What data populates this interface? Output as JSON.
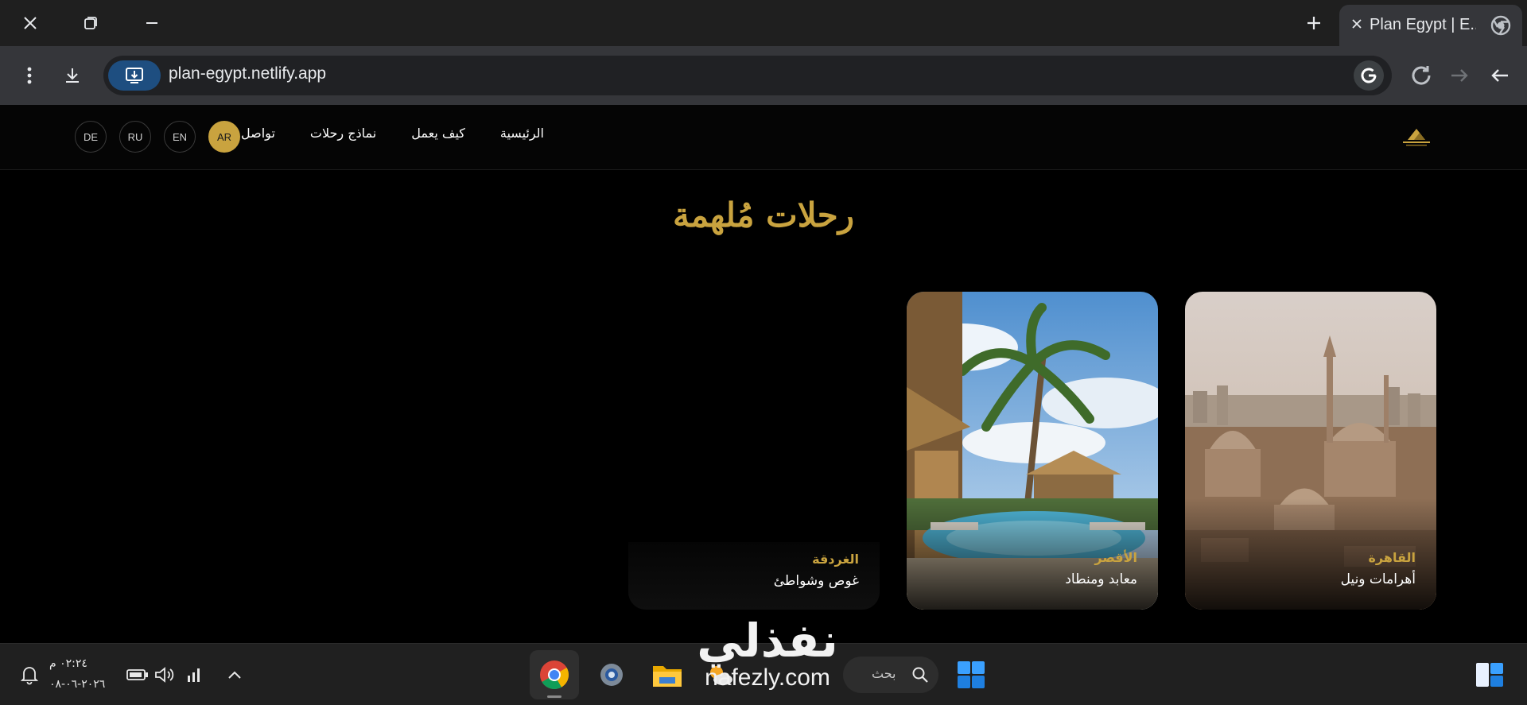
{
  "browser": {
    "tab_title": "Plan Egypt | E...",
    "url": "plan-egypt.netlify.app"
  },
  "site": {
    "nav": [
      {
        "id": "home",
        "label": "الرئيسية"
      },
      {
        "id": "how",
        "label": "كيف يعمل"
      },
      {
        "id": "samples",
        "label": "نماذج رحلات"
      },
      {
        "id": "contact",
        "label": "تواصل"
      }
    ],
    "languages": [
      "AR",
      "EN",
      "RU",
      "DE"
    ],
    "active_language": "AR",
    "hero_title": "رحلات مُلهمة",
    "accent_color": "#c9a33f",
    "cards": [
      {
        "city": "القاهرة",
        "subtitle": "أهرامات ونيل"
      },
      {
        "city": "الأقصر",
        "subtitle": "معابد ومنطاد"
      },
      {
        "city": "الغردقة",
        "subtitle": "غوص وشواطئ"
      }
    ]
  },
  "taskbar": {
    "search_placeholder": "بحث",
    "time": "٠٢:٢٤ م",
    "date": "٢٠٢٦-٠٦-٠٨",
    "watermark_ar": "نفذلي",
    "watermark_en": "nafezly.com"
  }
}
